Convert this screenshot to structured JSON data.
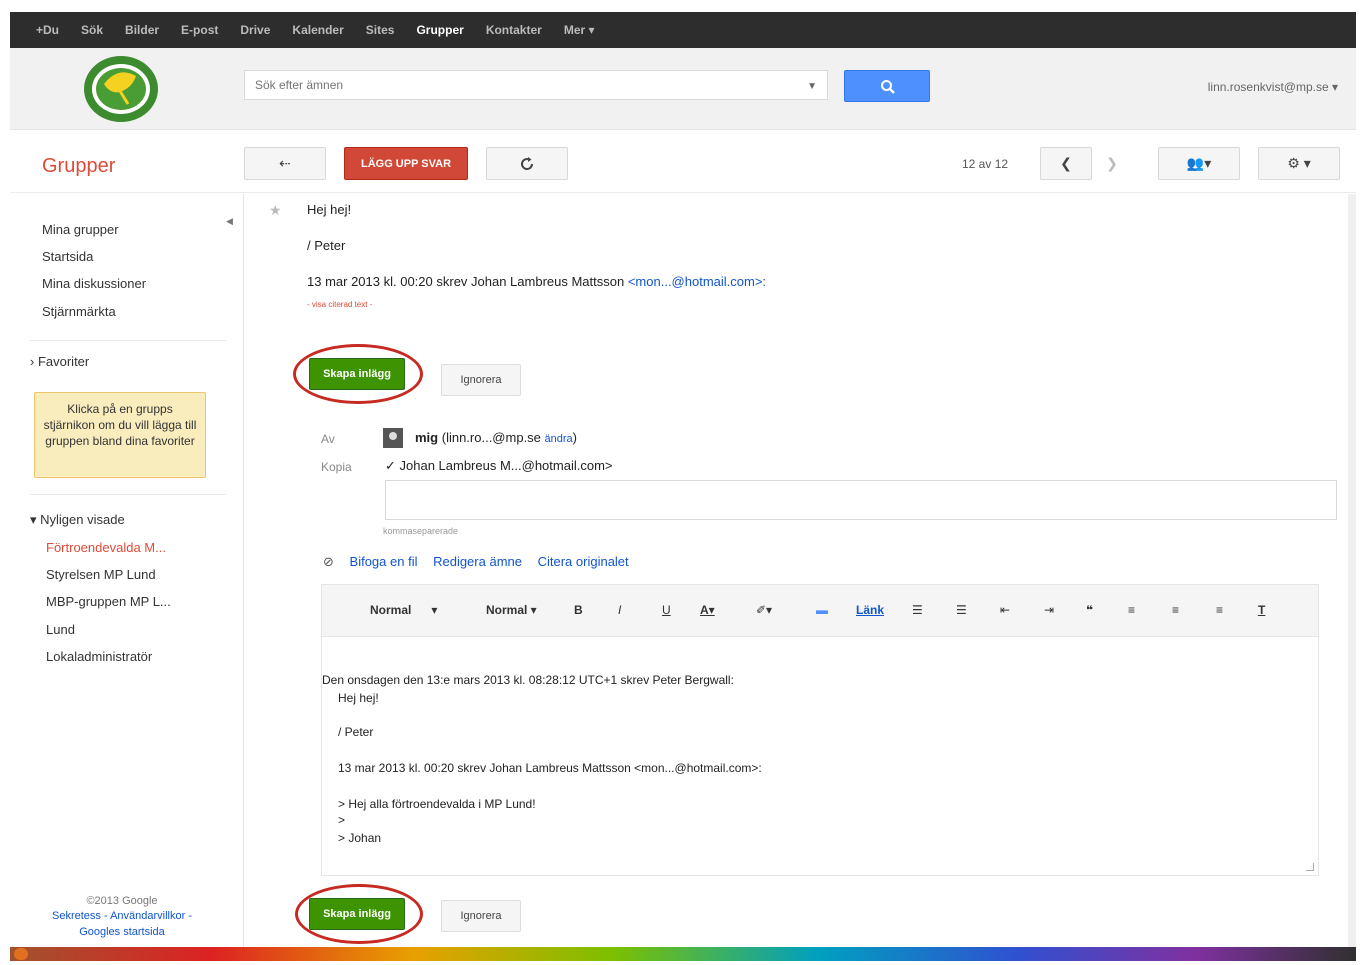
{
  "gbar": {
    "items": [
      "+Du",
      "Sök",
      "Bilder",
      "E-post",
      "Drive",
      "Kalender",
      "Sites",
      "Grupper",
      "Kontakter",
      "Mer ▾"
    ],
    "active_index": 7
  },
  "header": {
    "search_placeholder": "Sök efter ämnen",
    "account": "linn.rosenkvist@mp.se ▾"
  },
  "toolbar": {
    "app_title": "Grupper",
    "reply_post_label": "LÄGG UPP SVAR",
    "pager": "12 av 12"
  },
  "leftnav": {
    "items": [
      "Mina grupper",
      "Startsida",
      "Mina diskussioner",
      "Stjärnmärkta"
    ],
    "favorites_label": "Favoriter",
    "favorites_hint": "Klicka på en grupps stjärnikon om du vill lägga till gruppen bland dina favoriter",
    "recent_label": "Nyligen visade",
    "recent_items": [
      "Förtroendevalda M...",
      "Styrelsen MP Lund",
      "MBP-gruppen MP L...",
      "Lund",
      "Lokaladministratör"
    ],
    "footer_copyright": "©2013 Google",
    "footer_links": "Sekretess - Användarvillkor - Googles startsida"
  },
  "message": {
    "line1": "Hej hej!",
    "line2": "/ Peter",
    "quote_intro": "13 mar 2013 kl. 00:20 skrev Johan Lambreus Mattsson ",
    "quote_email": "<mon...@hotmail.com>:",
    "show_quoted": "- visa citerad text -"
  },
  "reply": {
    "post_label": "Skapa inlägg",
    "ignore_label": "Ignorera",
    "from_label": "Av",
    "from_name": "mig",
    "from_email": " (linn.ro...@mp.se ",
    "change_link": "ändra",
    "from_close": ")",
    "cc_label": "Kopia",
    "cc_value": "✓ Johan Lambreus M...@hotmail.com>",
    "note": "kommaseparerade",
    "attach": "Bifoga en fil",
    "edit_subject": "Redigera ämne",
    "quote_original": "Citera originalet"
  },
  "editor": {
    "font": "Normal",
    "size": "Normal",
    "link": "Länk",
    "quote_header": "Den onsdagen den 13:e mars 2013 kl. 08:28:12 UTC+1 skrev Peter Bergwall:",
    "q_line1": "Hej hej!",
    "q_line2": "/ Peter",
    "q_line3": "13 mar 2013 kl. 00:20 skrev Johan Lambreus Mattsson <mon...@hotmail.com>:",
    "q_line4": "> Hej alla förtroendevalda i MP Lund!",
    "q_line5": ">",
    "q_line6": "> Johan"
  },
  "colors": {
    "brand_red": "#dd4b39",
    "post_green": "#3d9400",
    "search_blue": "#4d90fe",
    "ring_red": "#c62a22"
  }
}
